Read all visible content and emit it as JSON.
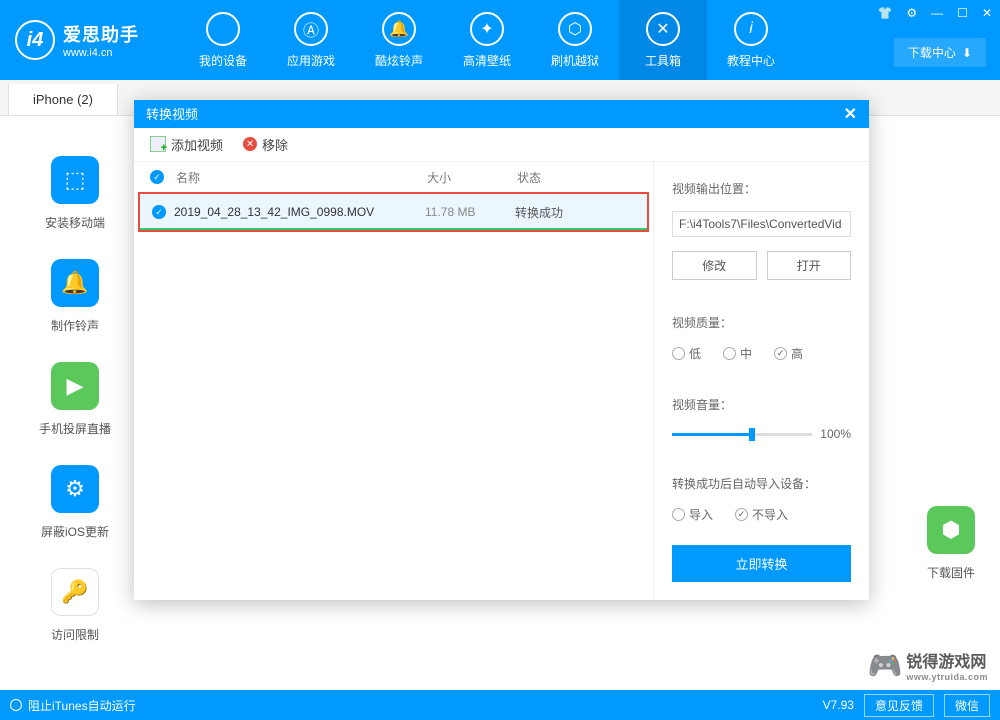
{
  "app": {
    "name_cn": "爱思助手",
    "url": "www.i4.cn"
  },
  "winControls": {
    "download_center": "下载中心"
  },
  "nav": [
    {
      "label": "我的设备",
      "icon": "apple"
    },
    {
      "label": "应用游戏",
      "icon": "apps"
    },
    {
      "label": "酷炫铃声",
      "icon": "bell"
    },
    {
      "label": "高清壁纸",
      "icon": "sparkle"
    },
    {
      "label": "刷机越狱",
      "icon": "box"
    },
    {
      "label": "工具箱",
      "icon": "tools",
      "active": true
    },
    {
      "label": "教程中心",
      "icon": "info"
    }
  ],
  "tab": {
    "label": "iPhone (2)"
  },
  "sidebar": [
    {
      "label": "安装移动端",
      "icon": "install",
      "color": "blue"
    },
    {
      "label": "制作铃声",
      "icon": "ring",
      "color": "blue"
    },
    {
      "label": "手机投屏直播",
      "icon": "cast",
      "color": "green"
    },
    {
      "label": "屏蔽iOS更新",
      "icon": "block",
      "color": "blue"
    },
    {
      "label": "访问限制",
      "icon": "key",
      "color": "white"
    }
  ],
  "rightDownload": {
    "label": "下载固件"
  },
  "dialog": {
    "title": "转换视频",
    "toolbar": {
      "add": "添加视频",
      "remove": "移除"
    },
    "columns": {
      "name": "名称",
      "size": "大小",
      "status": "状态"
    },
    "file": {
      "name": "2019_04_28_13_42_IMG_0998.MOV",
      "size": "11.78 MB",
      "status": "转换成功"
    },
    "options": {
      "output_label": "视频输出位置：",
      "output_path": "F:\\i4Tools7\\Files\\ConvertedVid",
      "modify": "修改",
      "open": "打开",
      "quality_label": "视频质量：",
      "quality": {
        "low": "低",
        "mid": "中",
        "high": "高",
        "selected": "高"
      },
      "volume_label": "视频音量：",
      "volume_value": "100%",
      "import_label": "转换成功后自动导入设备：",
      "import": {
        "yes": "导入",
        "no": "不导入",
        "selected": "不导入"
      },
      "convert": "立即转换"
    }
  },
  "bottom": {
    "itunes": "阻止iTunes自动运行",
    "version": "V7.93",
    "feedback": "意见反馈",
    "wechat": "微信"
  },
  "watermark": {
    "cn": "锐得游戏网",
    "en": "www.ytruida.com"
  }
}
